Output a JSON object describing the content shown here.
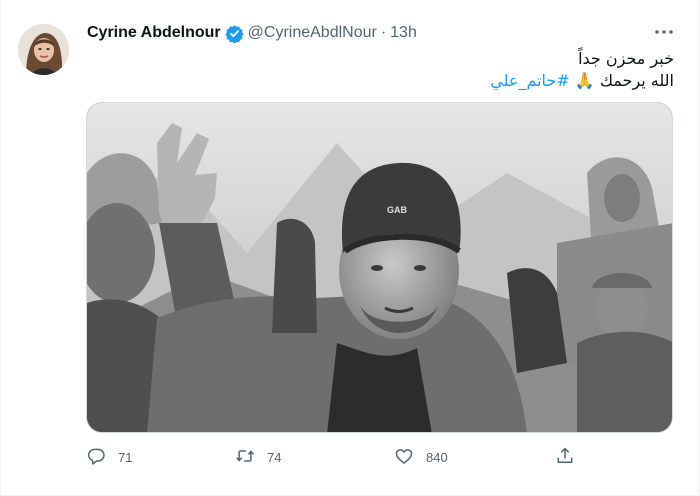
{
  "tweet": {
    "display_name": "Cyrine Abdelnour",
    "handle": "@CyrineAbdlNour",
    "separator": "·",
    "time": "13h",
    "text_line1": "خبر محزن جداً",
    "text_line2_prefix": "الله يرحمك 🙏 ",
    "hashtag": "#حاتم_علي",
    "media_cap_text": "GAB",
    "icons": {
      "more": "more-dots-icon",
      "verified": "verified-badge-icon",
      "reply": "reply-icon",
      "retweet": "retweet-icon",
      "like": "like-icon",
      "share": "share-icon"
    },
    "colors": {
      "verified": "#1d9bf0",
      "hashtag": "#1d9bf0",
      "muted": "#536471"
    }
  },
  "actions": {
    "reply_count": "71",
    "retweet_count": "74",
    "like_count": "840"
  }
}
